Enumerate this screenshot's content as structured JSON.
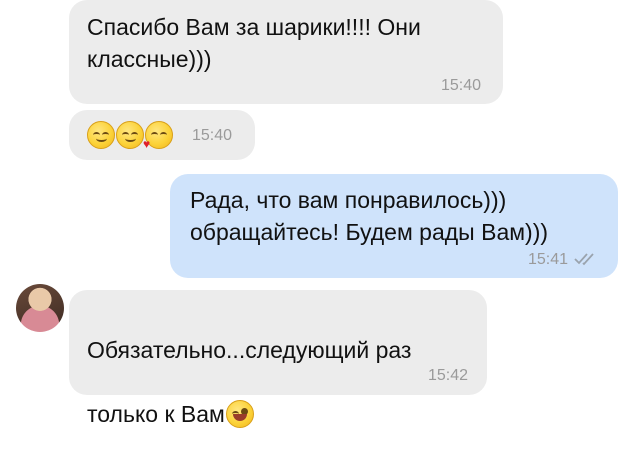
{
  "messages": [
    {
      "text": "Спасибо Вам за шарики!!!! Они\nклассные)))",
      "time": "15:40"
    },
    {
      "emojis": [
        "smiling-face-icon",
        "smiling-face-icon",
        "blowing-kiss-face-icon"
      ],
      "time": "15:40"
    },
    {
      "text": "Рада, что вам понравилось)))\nобращайтесь! Будем рады Вам)))",
      "time": "15:41"
    },
    {
      "text_line1": "Обязательно...следующий раз",
      "text_line2": "только к Вам",
      "time": "15:42",
      "emoji": "winking-face-icon"
    }
  ],
  "colors": {
    "incoming": "#ececec",
    "outgoing": "#cfe3fb",
    "time": "#9a9a9a",
    "checks": "#9aa3ad"
  }
}
